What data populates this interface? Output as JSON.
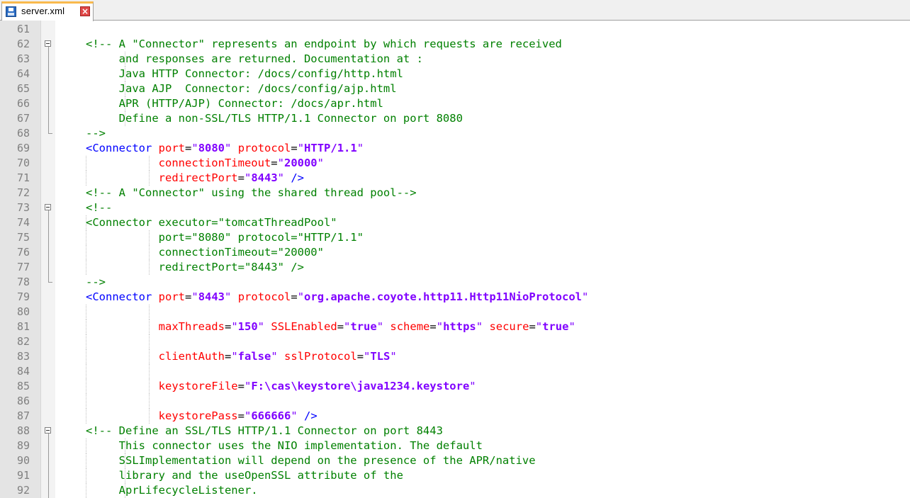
{
  "tab": {
    "filename": "server.xml",
    "close_glyph": "×"
  },
  "lines": [
    {
      "n": "61",
      "fold": "",
      "text": ""
    },
    {
      "n": "62",
      "fold": "start",
      "text": "<!-- A \"Connector\" represents an endpoint by which requests are received"
    },
    {
      "n": "63",
      "fold": "in",
      "text": "     and responses are returned. Documentation at :"
    },
    {
      "n": "64",
      "fold": "in",
      "text": "     Java HTTP Connector: /docs/config/http.html"
    },
    {
      "n": "65",
      "fold": "in",
      "text": "     Java AJP  Connector: /docs/config/ajp.html"
    },
    {
      "n": "66",
      "fold": "in",
      "text": "     APR (HTTP/AJP) Connector: /docs/apr.html"
    },
    {
      "n": "67",
      "fold": "in",
      "text": "     Define a non-SSL/TLS HTTP/1.1 Connector on port 8080"
    },
    {
      "n": "68",
      "fold": "end",
      "text": "-->"
    },
    {
      "n": "69",
      "fold": "",
      "text": "<Connector port=\"8080\" protocol=\"HTTP/1.1\""
    },
    {
      "n": "70",
      "fold": "",
      "text": "           connectionTimeout=\"20000\""
    },
    {
      "n": "71",
      "fold": "",
      "text": "           redirectPort=\"8443\" />"
    },
    {
      "n": "72",
      "fold": "",
      "text": "<!-- A \"Connector\" using the shared thread pool-->"
    },
    {
      "n": "73",
      "fold": "start",
      "text": "<!--"
    },
    {
      "n": "74",
      "fold": "in",
      "text": "<Connector executor=\"tomcatThreadPool\""
    },
    {
      "n": "75",
      "fold": "in",
      "text": "           port=\"8080\" protocol=\"HTTP/1.1\""
    },
    {
      "n": "76",
      "fold": "in",
      "text": "           connectionTimeout=\"20000\""
    },
    {
      "n": "77",
      "fold": "in",
      "text": "           redirectPort=\"8443\" />"
    },
    {
      "n": "78",
      "fold": "end",
      "text": "-->"
    },
    {
      "n": "79",
      "fold": "",
      "text": "<Connector port=\"8443\" protocol=\"org.apache.coyote.http11.Http11NioProtocol\""
    },
    {
      "n": "80",
      "fold": "",
      "text": ""
    },
    {
      "n": "81",
      "fold": "",
      "text": "           maxThreads=\"150\" SSLEnabled=\"true\" scheme=\"https\" secure=\"true\""
    },
    {
      "n": "82",
      "fold": "",
      "text": ""
    },
    {
      "n": "83",
      "fold": "",
      "text": "           clientAuth=\"false\" sslProtocol=\"TLS\""
    },
    {
      "n": "84",
      "fold": "",
      "text": ""
    },
    {
      "n": "85",
      "fold": "",
      "text": "           keystoreFile=\"F:\\cas\\keystore\\java1234.keystore\""
    },
    {
      "n": "86",
      "fold": "",
      "text": ""
    },
    {
      "n": "87",
      "fold": "",
      "text": "           keystorePass=\"666666\" />"
    },
    {
      "n": "88",
      "fold": "start",
      "text": "<!-- Define an SSL/TLS HTTP/1.1 Connector on port 8443"
    },
    {
      "n": "89",
      "fold": "in",
      "text": "     This connector uses the NIO implementation. The default"
    },
    {
      "n": "90",
      "fold": "in",
      "text": "     SSLImplementation will depend on the presence of the APR/native"
    },
    {
      "n": "91",
      "fold": "in",
      "text": "     library and the useOpenSSL attribute of the"
    },
    {
      "n": "92",
      "fold": "in",
      "text": "     AprLifecycleListener."
    }
  ]
}
